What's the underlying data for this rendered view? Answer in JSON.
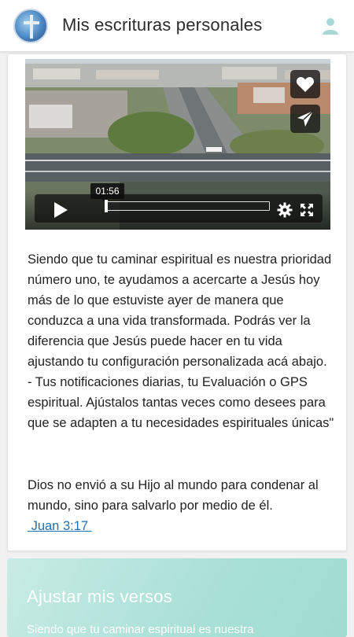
{
  "header": {
    "title": "Mis escrituras personales",
    "logo_icon": "church-cross-logo",
    "profile_icon": "user-icon"
  },
  "video": {
    "timestamp": "01:56",
    "progress_fraction": 0.0,
    "actions": [
      "heart-icon",
      "send-icon"
    ],
    "controls": [
      "play-icon",
      "gear-icon",
      "fullscreen-icon"
    ]
  },
  "content": {
    "paragraph": "Siendo que tu caminar espiritual es nuestra prioridad número uno, te ayudamos a acercarte a Jesús hoy más de lo que estuviste ayer de manera que conduzca a una vida transformada. Podrás ver la diferencia que Jesús puede hacer en tu vida ajustando tu configuración personalizada acá abajo. - Tus notificaciones diarias, tu Evaluación o GPS espiritual. Ajústalos tantas veces como desees para que se adapten a tu necesidades espirituales únicas\"",
    "verse": "Dios no envió a su Hijo al mundo para condenar al mundo, sino para salvarlo por medio de él.",
    "verse_ref": " Juan 3:17 "
  },
  "section": {
    "title": "Ajustar mis versos",
    "subtitle": "Siendo que tu caminar espiritual es nuestra"
  },
  "colors": {
    "link": "#1f6fb2",
    "section_bg": "#a9e0d6",
    "profile_icon": "#a6d9d6"
  }
}
